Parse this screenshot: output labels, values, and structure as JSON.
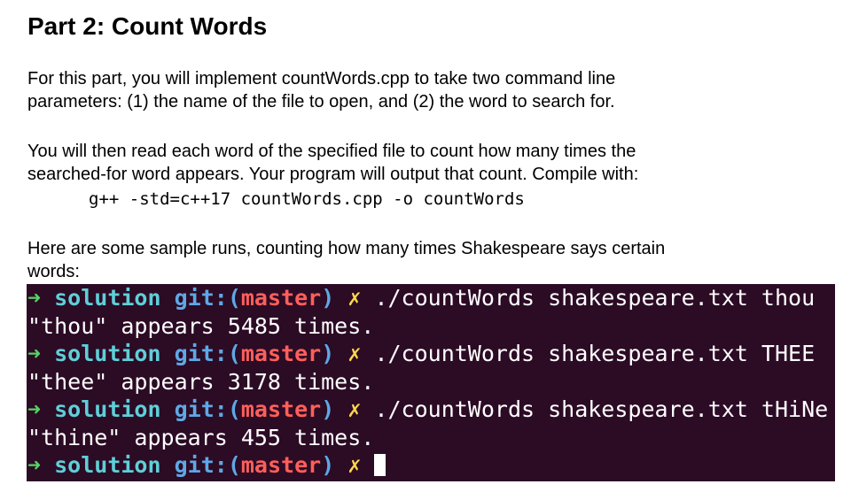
{
  "heading": "Part 2: Count Words",
  "paragraphs": {
    "intro_line1": "For this part, you will implement countWords.cpp to take two command line",
    "intro_line2": "parameters: (1) the name of the file to open, and (2) the word to search for.",
    "desc_line1": "You will then read each word of the specified file to count how many times the",
    "desc_line2": "searched-for word appears. Your program will output that count. Compile with:",
    "compile_command": "g++ -std=c++17 countWords.cpp -o countWords",
    "samples_line1": "Here are some sample runs, counting how many times Shakespeare says certain",
    "samples_line2": "words:"
  },
  "terminal": {
    "prompt": {
      "arrow": "➜",
      "dir": "solution",
      "git_label": "git:(",
      "branch": "master",
      "git_close": ")",
      "dirty_mark": "✗"
    },
    "runs": [
      {
        "command": "./countWords shakespeare.txt thou",
        "output": "\"thou\" appears 5485 times."
      },
      {
        "command": "./countWords shakespeare.txt THEE",
        "output": "\"thee\" appears 3178 times."
      },
      {
        "command": "./countWords shakespeare.txt tHiNe",
        "output": "\"thine\" appears 455 times."
      }
    ],
    "colors": {
      "background": "#2c0b25",
      "arrow": "#56d364",
      "dir": "#5fcfd8",
      "git": "#5fa8e6",
      "branch": "#ff5f5a",
      "dirty": "#ffd84a",
      "text": "#ffffff"
    }
  }
}
